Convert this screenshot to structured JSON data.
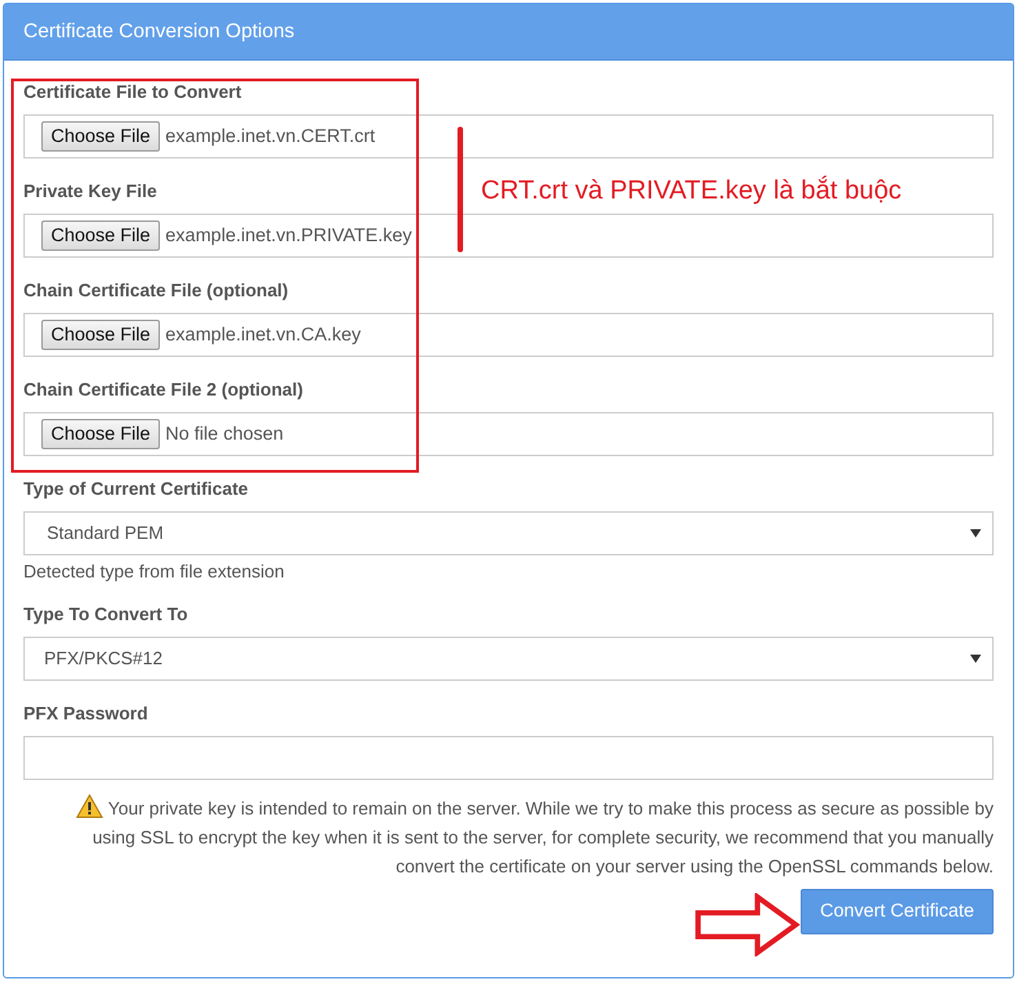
{
  "panel": {
    "title": "Certificate Conversion Options"
  },
  "fields": [
    {
      "kind": "file",
      "label": "Certificate File to Convert",
      "button": "Choose File",
      "value": "example.inet.vn.CERT.crt"
    },
    {
      "kind": "file",
      "label": "Private Key File",
      "button": "Choose File",
      "value": "example.inet.vn.PRIVATE.key"
    },
    {
      "kind": "file",
      "label": "Chain Certificate File (optional)",
      "button": "Choose File",
      "value": "example.inet.vn.CA.key"
    },
    {
      "kind": "file",
      "label": "Chain Certificate File 2 (optional)",
      "button": "Choose File",
      "value": "No file chosen"
    },
    {
      "kind": "select",
      "label": "Type of Current Certificate",
      "value": "Standard PEM",
      "help": "Detected type from file extension"
    },
    {
      "kind": "select",
      "label": "Type To Convert To",
      "value": "PFX/PKCS#12"
    },
    {
      "kind": "password",
      "label": "PFX Password"
    }
  ],
  "warning": "Your private key is intended to remain on the server. While we try to make this process as secure as possible by using SSL to encrypt the key when it is sent to the server, for complete security, we recommend that you manually convert the certificate on your server using the OpenSSL commands below.",
  "submit": "Convert Certificate",
  "annotation": {
    "note": "CRT.crt và PRIVATE.key là bắt buộc"
  }
}
